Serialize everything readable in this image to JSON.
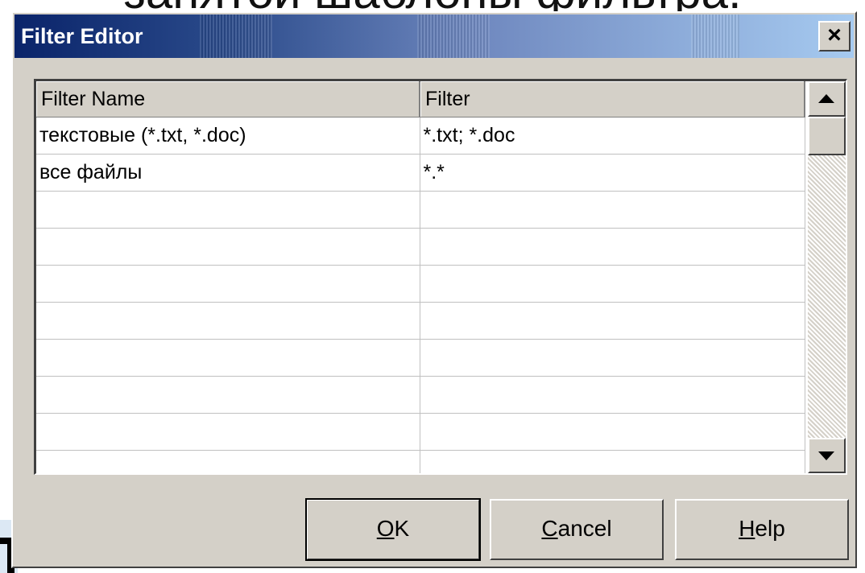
{
  "background": {
    "slide_text_partial": "занятой шаблоны фильтра."
  },
  "dialog": {
    "title": "Filter Editor",
    "close_label": "×"
  },
  "grid": {
    "columns": [
      "Filter Name",
      "Filter"
    ],
    "rows": [
      [
        "текстовые (*.txt, *.doc)",
        "*.txt; *.doc"
      ],
      [
        "все файлы",
        "*.*"
      ],
      [
        "",
        ""
      ],
      [
        "",
        ""
      ],
      [
        "",
        ""
      ],
      [
        "",
        ""
      ],
      [
        "",
        ""
      ],
      [
        "",
        ""
      ],
      [
        "",
        ""
      ],
      [
        "",
        ""
      ]
    ]
  },
  "buttons": {
    "ok": {
      "accel": "O",
      "rest": "K"
    },
    "cancel": {
      "accel": "C",
      "rest": "ancel"
    },
    "help": {
      "accel": "H",
      "rest": "elp"
    }
  },
  "colors": {
    "titlebar_start": "#0a246a",
    "titlebar_end": "#a6caf0",
    "face": "#d4d0c8"
  },
  "icons": {
    "close": "close-icon",
    "scroll_up": "arrow-up-icon",
    "scroll_down": "arrow-down-icon"
  }
}
